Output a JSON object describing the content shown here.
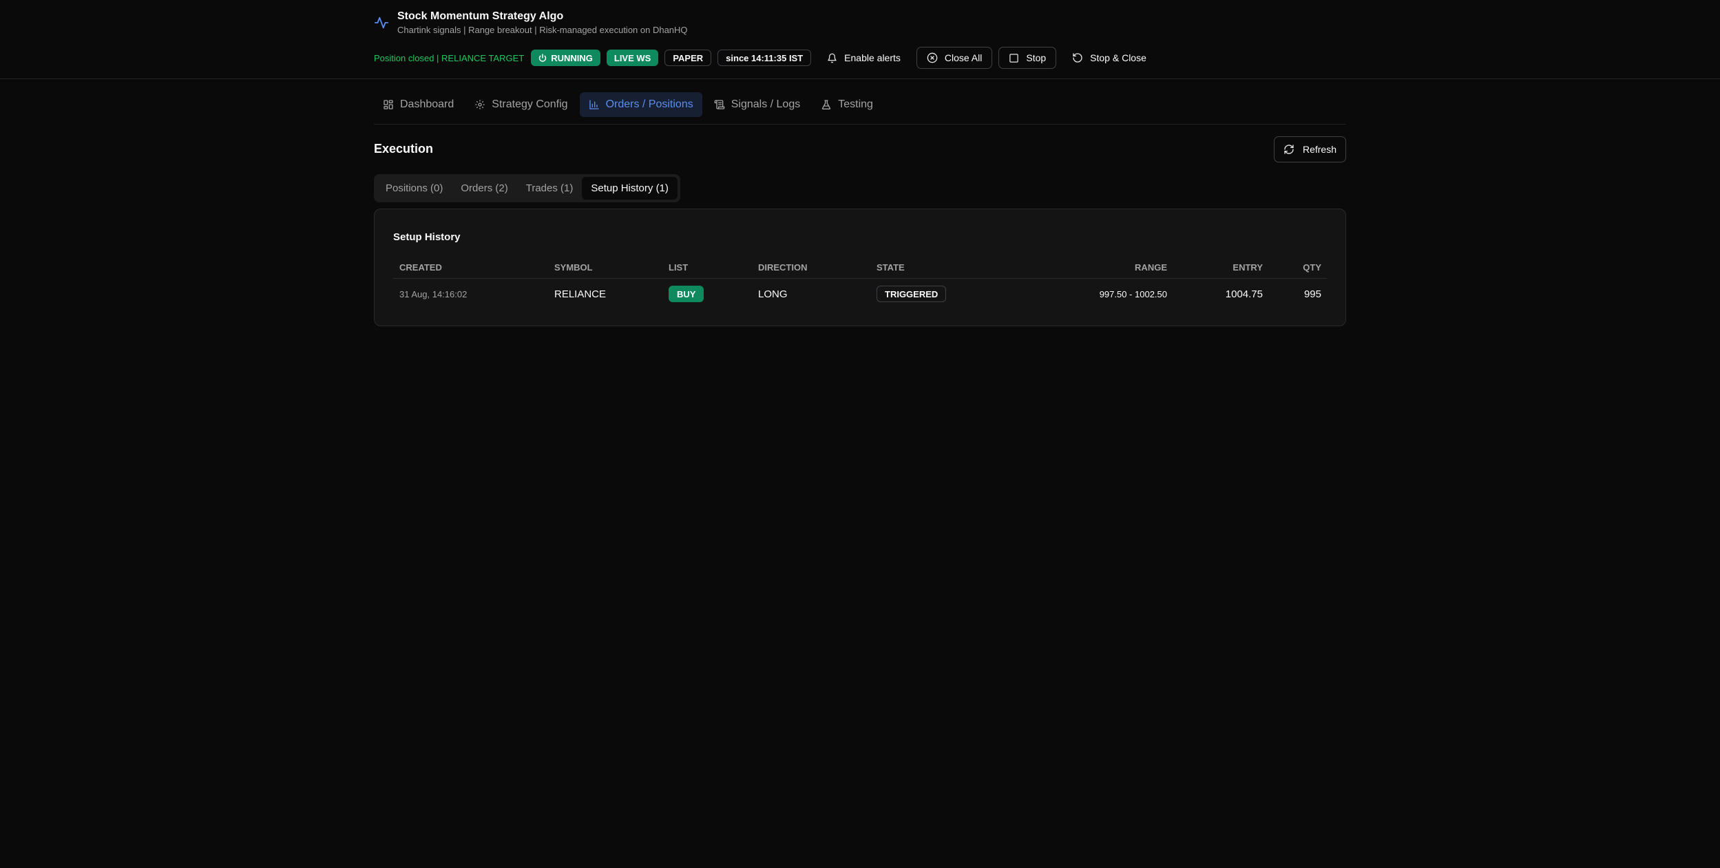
{
  "app": {
    "title": "Stock Momentum Strategy Algo",
    "subtitle": "Chartink signals | Range breakout | Risk-managed execution on DhanHQ"
  },
  "status": {
    "message": "Position closed | RELIANCE TARGET",
    "running": "RUNNING",
    "live_ws": "LIVE WS",
    "mode": "PAPER",
    "since": "since 14:11:35 IST",
    "enable_alerts": "Enable alerts",
    "close_all": "Close All",
    "stop": "Stop",
    "stop_close": "Stop & Close"
  },
  "nav": {
    "tabs": [
      {
        "label": "Dashboard",
        "icon": "grid-icon"
      },
      {
        "label": "Strategy Config",
        "icon": "gear-icon"
      },
      {
        "label": "Orders / Positions",
        "icon": "chart-icon",
        "active": true
      },
      {
        "label": "Signals / Logs",
        "icon": "scroll-icon"
      },
      {
        "label": "Testing",
        "icon": "flask-icon"
      }
    ]
  },
  "execution": {
    "title": "Execution",
    "refresh": "Refresh",
    "subtabs": [
      {
        "label": "Positions (0)"
      },
      {
        "label": "Orders (2)"
      },
      {
        "label": "Trades (1)"
      },
      {
        "label": "Setup History (1)",
        "active": true
      }
    ]
  },
  "setup_history": {
    "title": "Setup History",
    "columns": [
      "Created",
      "Symbol",
      "List",
      "Direction",
      "State",
      "Range",
      "Entry",
      "Qty"
    ],
    "rows": [
      {
        "created": "31 Aug, 14:16:02",
        "symbol": "RELIANCE",
        "list": "BUY",
        "direction": "LONG",
        "state": "TRIGGERED",
        "range": "997.50 - 1002.50",
        "entry": "1004.75",
        "qty": "995"
      }
    ]
  },
  "colors": {
    "accent": "#5b8def",
    "success": "#0f8a5f",
    "status_text": "#22c55e",
    "background": "#0a0a0a"
  }
}
